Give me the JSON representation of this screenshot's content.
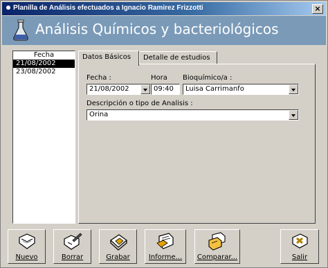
{
  "window": {
    "title": "Planilla de Análisis efectuados a Ignacio Ramirez Frizzotti",
    "close_glyph": "×"
  },
  "header": {
    "title": "Análisis Químicos y bacteriológicos",
    "icon": "flask-icon"
  },
  "date_list": {
    "header": "Fecha",
    "items": [
      "21/08/2002",
      "23/08/2002"
    ],
    "selected_index": 0
  },
  "tabs": [
    {
      "label": "Datos Básicos",
      "active": true
    },
    {
      "label": "Detalle de estudios",
      "active": false
    }
  ],
  "form": {
    "fecha_label": "Fecha :",
    "fecha_value": "21/08/2002",
    "hora_label": "Hora",
    "hora_value": "09:40",
    "bioquimico_label": "Bioquímico/a :",
    "bioquimico_value": "Luisa Carrimanfo",
    "descripcion_label": "Descripción o tipo de Analisis :",
    "descripcion_value": "Orina"
  },
  "toolbar": {
    "buttons": [
      {
        "label": "Nuevo",
        "icon": "new-document-icon"
      },
      {
        "label": "Borrar",
        "icon": "erase-document-icon"
      },
      {
        "label": "Grabar",
        "icon": "save-disk-icon"
      },
      {
        "label": "Informe...",
        "icon": "report-icon"
      },
      {
        "label": "Comparar...",
        "icon": "compare-icon"
      },
      {
        "label": "Salir",
        "icon": "exit-icon"
      }
    ]
  },
  "colors": {
    "title_gradient_start": "#0a246a",
    "header_bg": "#7a9ab8",
    "face": "#d4d0c8"
  }
}
